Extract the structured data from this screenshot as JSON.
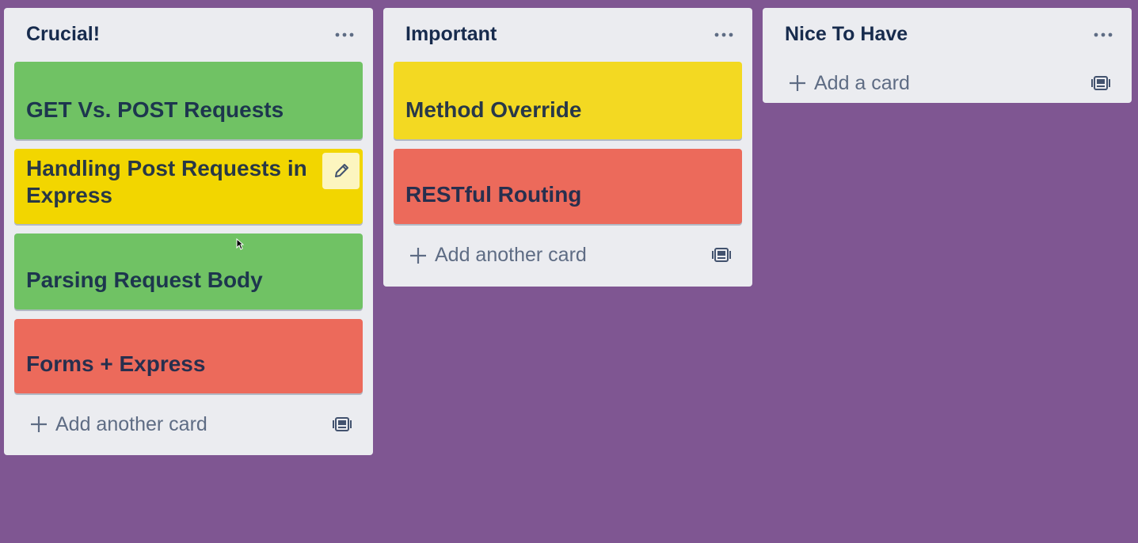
{
  "colors": {
    "board_background": "#7f5692",
    "list_background": "#ebecf0",
    "label_green": "#70c264",
    "label_yellow": "#f2d600",
    "label_red": "#ec6a5b",
    "text_primary": "#172b4d",
    "text_secondary": "#5e6c84"
  },
  "lists": [
    {
      "title": "Crucial!",
      "menu_icon": "ellipsis-icon",
      "cards": [
        {
          "title": "GET Vs. POST Requests",
          "color": "green"
        },
        {
          "title": "Handling Post Requests in Express",
          "color": "yellow",
          "hovered": true,
          "edit_icon": "pencil-icon"
        },
        {
          "title": "Parsing Request Body",
          "color": "green"
        },
        {
          "title": "Forms + Express",
          "color": "red"
        }
      ],
      "add_label": "Add another card",
      "template_icon": "card-template-icon"
    },
    {
      "title": "Important",
      "menu_icon": "ellipsis-icon",
      "cards": [
        {
          "title": "Method Override",
          "color": "yellow"
        },
        {
          "title": "RESTful Routing",
          "color": "red"
        }
      ],
      "add_label": "Add another card",
      "template_icon": "card-template-icon"
    },
    {
      "title": "Nice To Have",
      "menu_icon": "ellipsis-icon",
      "cards": [],
      "add_label": "Add a card",
      "template_icon": "card-template-icon"
    }
  ]
}
